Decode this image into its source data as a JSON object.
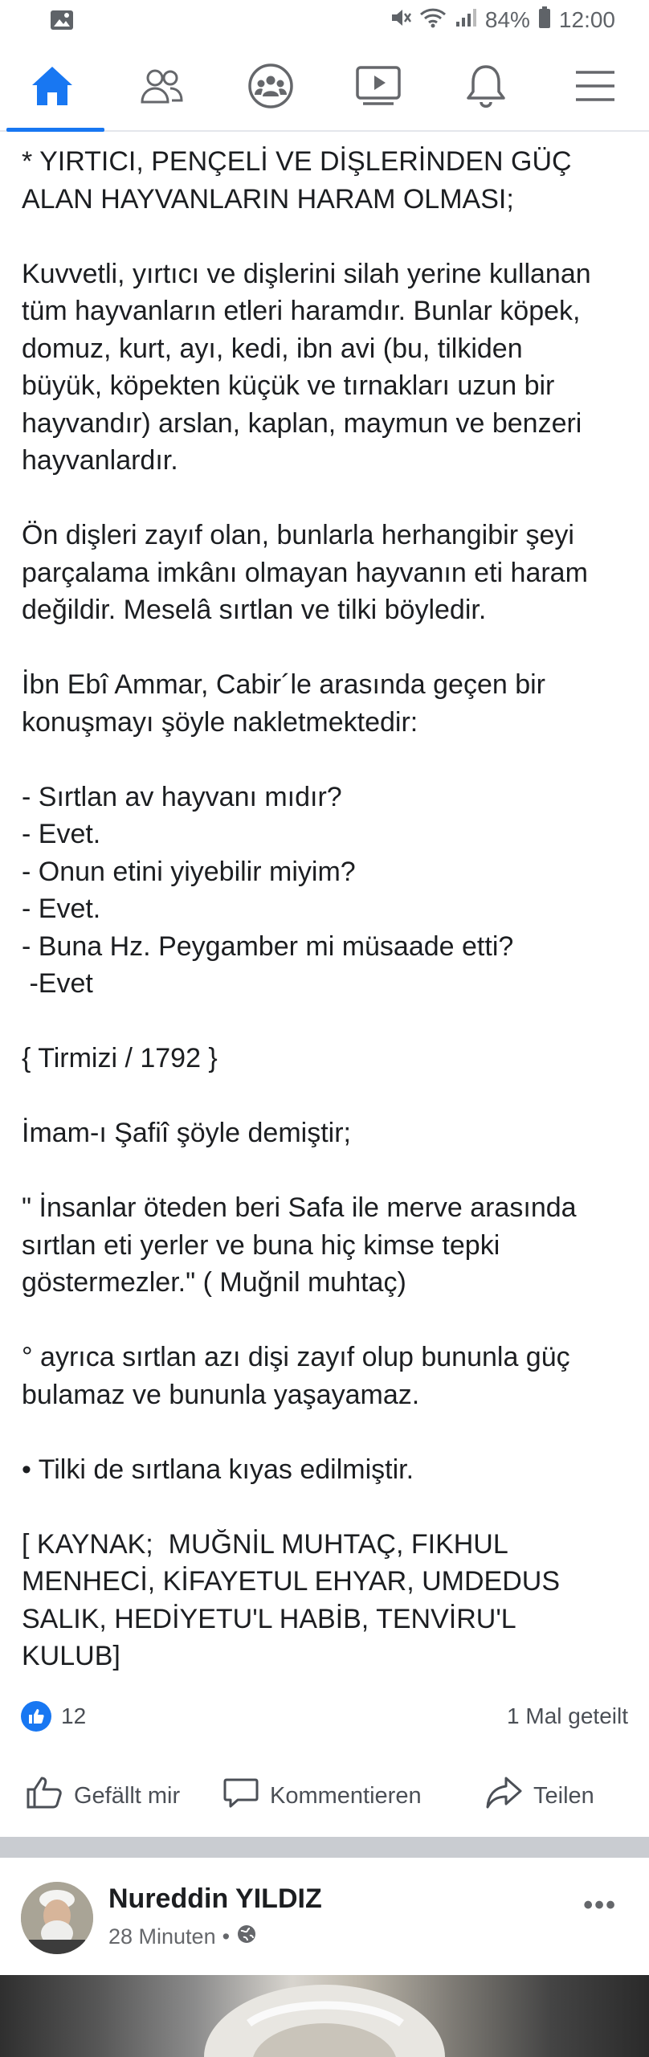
{
  "status_bar": {
    "battery": "84%",
    "time": "12:00"
  },
  "nav": {
    "items": [
      {
        "icon": "home-icon",
        "active": true
      },
      {
        "icon": "friends-icon",
        "active": false
      },
      {
        "icon": "groups-icon",
        "active": false
      },
      {
        "icon": "watch-icon",
        "active": false
      },
      {
        "icon": "notifications-icon",
        "active": false
      },
      {
        "icon": "menu-icon",
        "active": false
      }
    ],
    "accent": "#1877f2"
  },
  "post": {
    "lines": [
      "* YIRTICI, PENÇELİ VE DİŞLERİNDEN GÜÇ",
      "ALAN HAYVANLARIN HARAM OLMASI;",
      "",
      "Kuvvetli, yırtıcı ve dişlerini silah yerine kullanan",
      "tüm hayvanların etleri haramdır. Bunlar köpek,",
      "domuz, kurt, ayı, kedi, ibn avi (bu, tilkiden",
      "büyük, köpekten küçük ve tırnakları uzun bir",
      "hayvandır) arslan, kaplan, maymun ve benzeri",
      "hayvanlardır.",
      "",
      "Ön dişleri zayıf olan, bunlarla herhangibir şeyi",
      "parçalama imkânı olmayan hayvanın eti haram",
      "değildir. Meselâ sırtlan ve tilki böyledir.",
      "",
      "İbn Ebî Ammar, Cabir´le arasında geçen bir",
      "konuşmayı şöyle nakletmektedir:",
      "",
      "- Sırtlan av hayvanı mıdır?",
      "- Evet.",
      "- Onun etini yiyebilir miyim?",
      "- Evet.",
      "- Buna Hz. Peygamber mi müsaade etti?",
      " -Evet",
      "",
      "{ Tirmizi / 1792 }",
      "",
      "İmam-ı Şafiî şöyle demiştir;",
      "",
      "\" İnsanlar öteden beri Safa ile merve arasında",
      "sırtlan eti yerler ve buna hiç kimse tepki",
      "göstermezler.\" ( Muğnil muhtaç)",
      "",
      "° ayrıca sırtlan azı dişi zayıf olup bununla güç",
      "bulamaz ve bununla yaşayamaz.",
      "",
      "• Tilki de sırtlana kıyas edilmiştir.",
      "",
      "[ KAYNAK;  MUĞNİL MUHTAÇ, FIKHUL",
      "MENHECİ, KİFAYETUL EHYAR, UMDEDUS",
      "SALIK, HEDİYETU'L HABİB, TENVİRU'L",
      "KULUB]"
    ]
  },
  "reactions": {
    "like_count": "12",
    "share_count": "1 Mal geteilt"
  },
  "actions": {
    "like": "Gefällt mir",
    "comment": "Kommentieren",
    "share": "Teilen"
  },
  "next_post": {
    "author": "Nureddin YILDIZ",
    "time": "28 Minuten",
    "separator": "•",
    "more": "•••"
  }
}
